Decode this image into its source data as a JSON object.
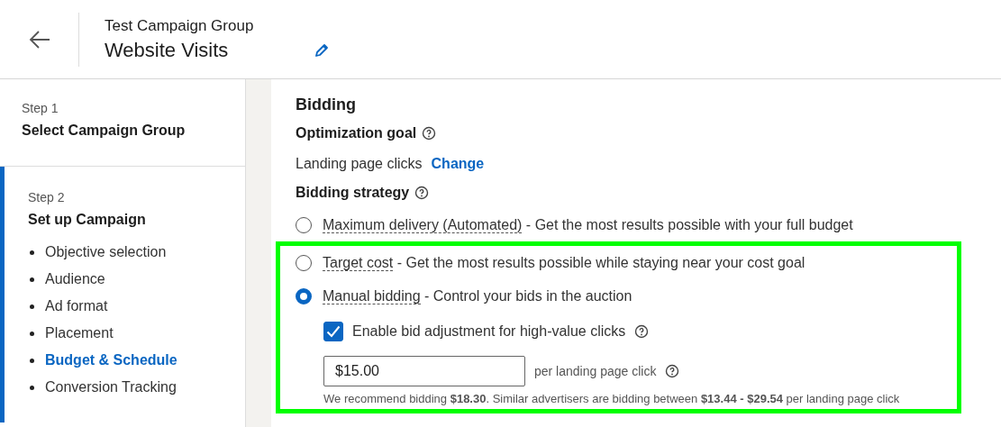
{
  "header": {
    "group_name": "Test Campaign Group",
    "campaign_name": "Website Visits"
  },
  "steps": [
    {
      "step": "Step 1",
      "title": "Select Campaign Group",
      "selected": false
    },
    {
      "step": "Step 2",
      "title": "Set up Campaign",
      "selected": true,
      "items": [
        {
          "label": "Objective selection",
          "selected": false
        },
        {
          "label": "Audience",
          "selected": false
        },
        {
          "label": "Ad format",
          "selected": false
        },
        {
          "label": "Placement",
          "selected": false
        },
        {
          "label": "Budget & Schedule",
          "selected": true
        },
        {
          "label": "Conversion Tracking",
          "selected": false
        }
      ]
    }
  ],
  "bidding": {
    "title": "Bidding",
    "optimization_label": "Optimization goal",
    "goal": "Landing page clicks",
    "change_link": "Change",
    "strategy_label": "Bidding strategy",
    "options": [
      {
        "term": "Maximum delivery (Automated)",
        "description": " - Get the most results possible with your full budget",
        "selected": false,
        "highlighted": false
      },
      {
        "term": "Target cost",
        "description": " - Get the most results possible while staying near your cost goal",
        "selected": false,
        "highlighted": true
      },
      {
        "term": "Manual bidding",
        "description": " - Control your bids in the auction",
        "selected": true,
        "highlighted": true
      }
    ],
    "adjustment": {
      "label": "Enable bid adjustment for high-value clicks",
      "checked": true
    },
    "bid": {
      "value": "$15.00",
      "unit": "per landing page click"
    },
    "recommendation": "We recommend bidding **$18.30**. Similar advertisers are bidding between **$13.44 - $29.54** per landing page click"
  }
}
